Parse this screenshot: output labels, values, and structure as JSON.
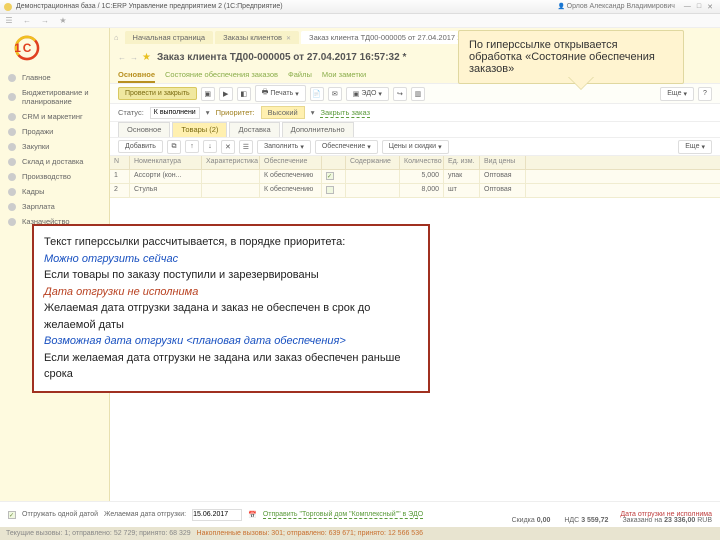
{
  "titlebar": {
    "text": "Демонстрационная база / 1С:ERP Управление предприятием 2  (1С:Предприятие)",
    "user": "Орлов Александр Владимирович"
  },
  "sidebar": {
    "items": [
      {
        "label": "Главное"
      },
      {
        "label": "Бюджетирование и планирование"
      },
      {
        "label": "CRM и маркетинг"
      },
      {
        "label": "Продажи"
      },
      {
        "label": "Закупки"
      },
      {
        "label": "Склад и доставка"
      },
      {
        "label": "Производство"
      },
      {
        "label": "Кадры"
      },
      {
        "label": "Зарплата"
      },
      {
        "label": "Казначейство"
      }
    ]
  },
  "tabs": {
    "home": "Начальная страница",
    "t1": "Заказы клиентов",
    "t2": "Заказ клиента ТД00-000005 от 27.04.2017 16:57:32 *"
  },
  "doc": {
    "title": "Заказ клиента ТД00-000005 от 27.04.2017 16:57:32 *"
  },
  "subtabs": {
    "i0": "Основное",
    "i1": "Состояние обеспечения заказов",
    "i2": "Файлы",
    "i3": "Мои заметки"
  },
  "toolbar": {
    "run": "Провести и закрыть",
    "print": "Печать",
    "edo": "ЭДО",
    "more": "Еще",
    "help": "?"
  },
  "row2": {
    "status": "Статус:",
    "stv": "К выполнению",
    "prio": "Приоритет:",
    "priov": "Высокий",
    "close": "Закрыть заказ"
  },
  "dtabs": {
    "i0": "Основное",
    "i1": "Товары (2)",
    "i2": "Доставка",
    "i3": "Дополнительно"
  },
  "gtb": {
    "add": "Добавить",
    "fill": "Заполнить",
    "obes": "Обеспечение",
    "price": "Цены и скидки",
    "more": "Еще"
  },
  "cols": {
    "n": "N",
    "nom": "Номенклатура",
    "har": "Характеристика",
    "ob": "Обеспечение",
    "sod": "Содержание",
    "kol": "Количество",
    "ed": "Ед. изм.",
    "vid": "Вид цены"
  },
  "rows": [
    {
      "n": "1",
      "nom": "Ассорти (кон...",
      "har": "",
      "ob": "К обеспечению",
      "chk": true,
      "sod": "",
      "kol": "5,000",
      "ed": "упак",
      "vid": "Оптовая"
    },
    {
      "n": "2",
      "nom": "Стулья",
      "har": "",
      "ob": "К обеспечению",
      "chk": false,
      "sod": "",
      "kol": "8,000",
      "ed": "шт",
      "vid": "Оптовая"
    }
  ],
  "footer": {
    "ship": "Отгружать одной датой",
    "wish": "Желаемая дата отгрузки:",
    "date": "15.06.2017",
    "edo": "Отправить \"Торговый дом \"Комплексный\"\" в ЭДО",
    "skidka_l": "Скидка",
    "skidka": "0,00",
    "nds_l": "НДС",
    "nds": "3 559,72",
    "zak_l": "Заказано на",
    "zak": "23 336,00",
    "cur": "RUB",
    "warn": "Дата отгрузки не исполнима"
  },
  "status": {
    "a": "Текущие вызовы: 1; отправлено: 52 729; принято: 68 329",
    "b": "Накопленные вызовы: 301; отправлено: 639 671; принято: 12 566 536"
  },
  "callout": "По гиперссылке открывается обработка «Состояние обеспечения заказов»",
  "overlay": {
    "l1": "Текст гиперссылки рассчитывается, в порядке приоритета:",
    "b1": "Можно отгрузить сейчас",
    "l2": "Если товары по заказу поступили и зарезервированы",
    "r1": "Дата отгрузки не исполнима",
    "l3": "Желаемая дата отгрузки задана и заказ не обеспечен в срок до желаемой даты",
    "b2": "Возможная дата отгрузки <плановая дата обеспечения>",
    "l4": "Если желаемая дата отгрузки не задана или заказ обеспечен раньше срока"
  }
}
